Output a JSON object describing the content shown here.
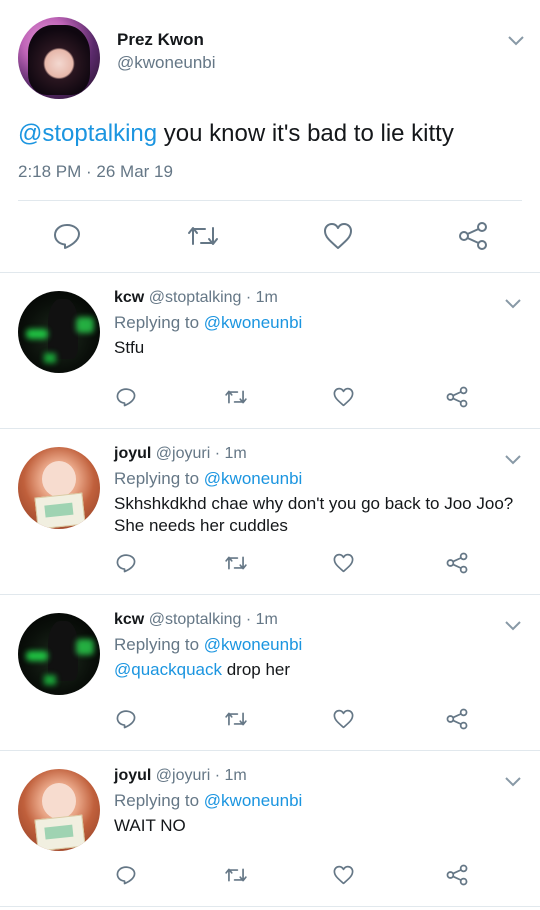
{
  "main_tweet": {
    "name": "Prez Kwon",
    "handle": "@kwoneunbi",
    "mention": "@stoptalking",
    "text": " you know it's bad to lie kitty",
    "timestamp": "2:18 PM · 26 Mar 19"
  },
  "replies": [
    {
      "name": "kcw",
      "meta": "@stoptalking · 1m",
      "replying_prefix": "Replying to ",
      "replying_to": "@kwoneunbi",
      "line1": "Stfu",
      "avatar": "kcw"
    },
    {
      "name": "joyul",
      "meta": "@joyuri · 1m",
      "replying_prefix": "Replying to ",
      "replying_to": "@kwoneunbi",
      "line1": "Skhshkdkhd chae why don't you go back to Joo Joo?",
      "line2": "She needs her cuddles",
      "avatar": "joyul"
    },
    {
      "name": "kcw",
      "meta": "@stoptalking · 1m",
      "replying_prefix": "Replying to ",
      "replying_to": "@kwoneunbi",
      "mention": "@quackquack",
      "line1": " drop her",
      "avatar": "kcw"
    },
    {
      "name": "joyul",
      "meta": "@joyuri · 1m",
      "replying_prefix": "Replying to ",
      "replying_to": "@kwoneunbi",
      "line1": "WAIT NO",
      "avatar": "joyul"
    }
  ],
  "icons": {
    "reply": "reply-icon",
    "retweet": "retweet-icon",
    "like": "like-icon",
    "share": "share-icon",
    "more": "chevron-down-icon"
  },
  "colors": {
    "link": "#1b95e0",
    "secondary": "#657786",
    "icon": "#657786",
    "divider": "#e1e8ed"
  }
}
